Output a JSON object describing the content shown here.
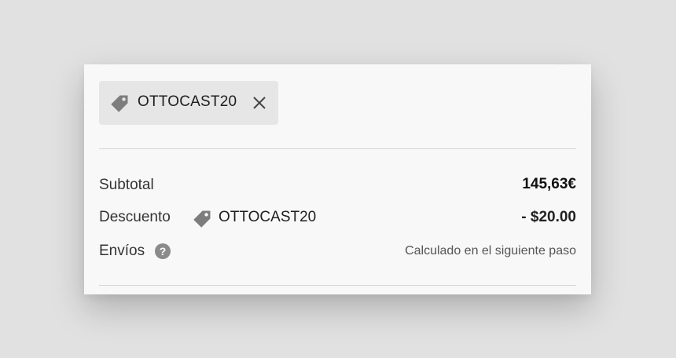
{
  "discount_chip": {
    "code": "OTTOCAST20",
    "tag_icon": "tag-icon",
    "remove_icon": "close-icon"
  },
  "summary": {
    "subtotal": {
      "label": "Subtotal",
      "value": "145,63€"
    },
    "discount": {
      "label": "Descuento",
      "code": "OTTOCAST20",
      "tag_icon": "tag-icon",
      "value": "- $20.00"
    },
    "shipping": {
      "label": "Envíos",
      "help_icon": "question-circle-icon",
      "help_glyph": "?",
      "value": "Calculado en el siguiente paso"
    }
  },
  "colors": {
    "page_background": "#e1e1e1",
    "card_background": "#f8f8f8",
    "chip_background": "#e6e6e6",
    "icon_gray": "#7d7d7d"
  }
}
